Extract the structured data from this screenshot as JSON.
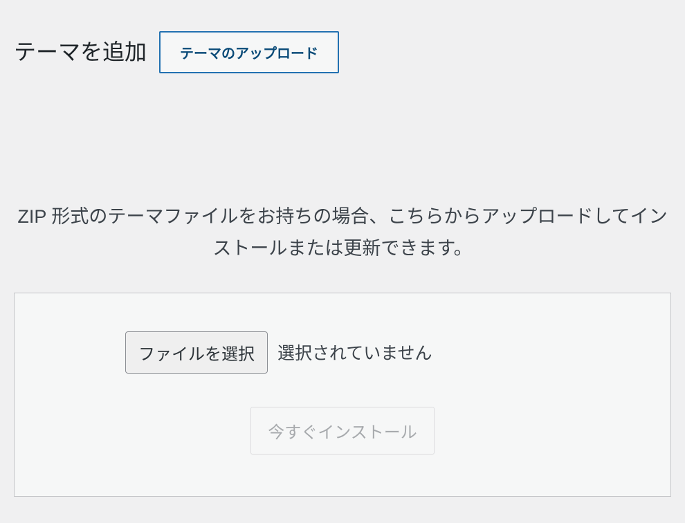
{
  "header": {
    "title": "テーマを追加",
    "upload_button": "テーマのアップロード"
  },
  "upload": {
    "description": "ZIP 形式のテーマファイルをお持ちの場合、こちらからアップロードしてインストールまたは更新できます。",
    "file_select_label": "ファイルを選択",
    "file_status": "選択されていません",
    "install_button": "今すぐインストール"
  }
}
